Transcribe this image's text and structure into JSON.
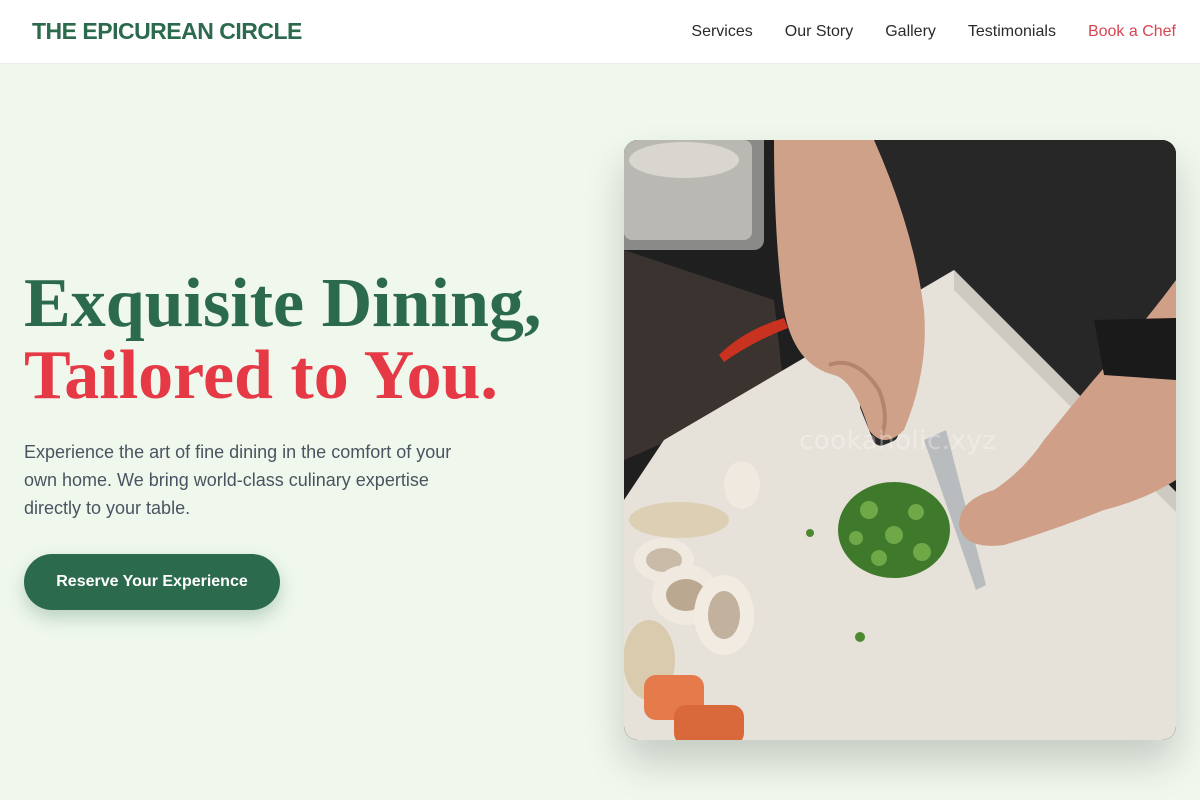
{
  "brand": {
    "name": "THE EPICUREAN CIRCLE"
  },
  "nav": {
    "items": [
      {
        "label": "Services"
      },
      {
        "label": "Our Story"
      },
      {
        "label": "Gallery"
      },
      {
        "label": "Testimonials"
      }
    ],
    "cta_label": "Book a Chef"
  },
  "hero": {
    "headline_line1": "Exquisite Dining,",
    "headline_line2": "Tailored to You.",
    "description": "Experience the art of fine dining in the comfort of your own home. We bring world-class culinary expertise directly to your table.",
    "button_label": "Reserve Your Experience",
    "image": {
      "subject": "chef-chopping-vegetables-photo",
      "watermark": "cookaholic.xyz"
    }
  },
  "colors": {
    "brand_green": "#2c6a4d",
    "accent_red": "#e63946",
    "nav_cta_red": "#d64550",
    "page_background": "#f0f8ee",
    "body_text": "#4b5360"
  }
}
